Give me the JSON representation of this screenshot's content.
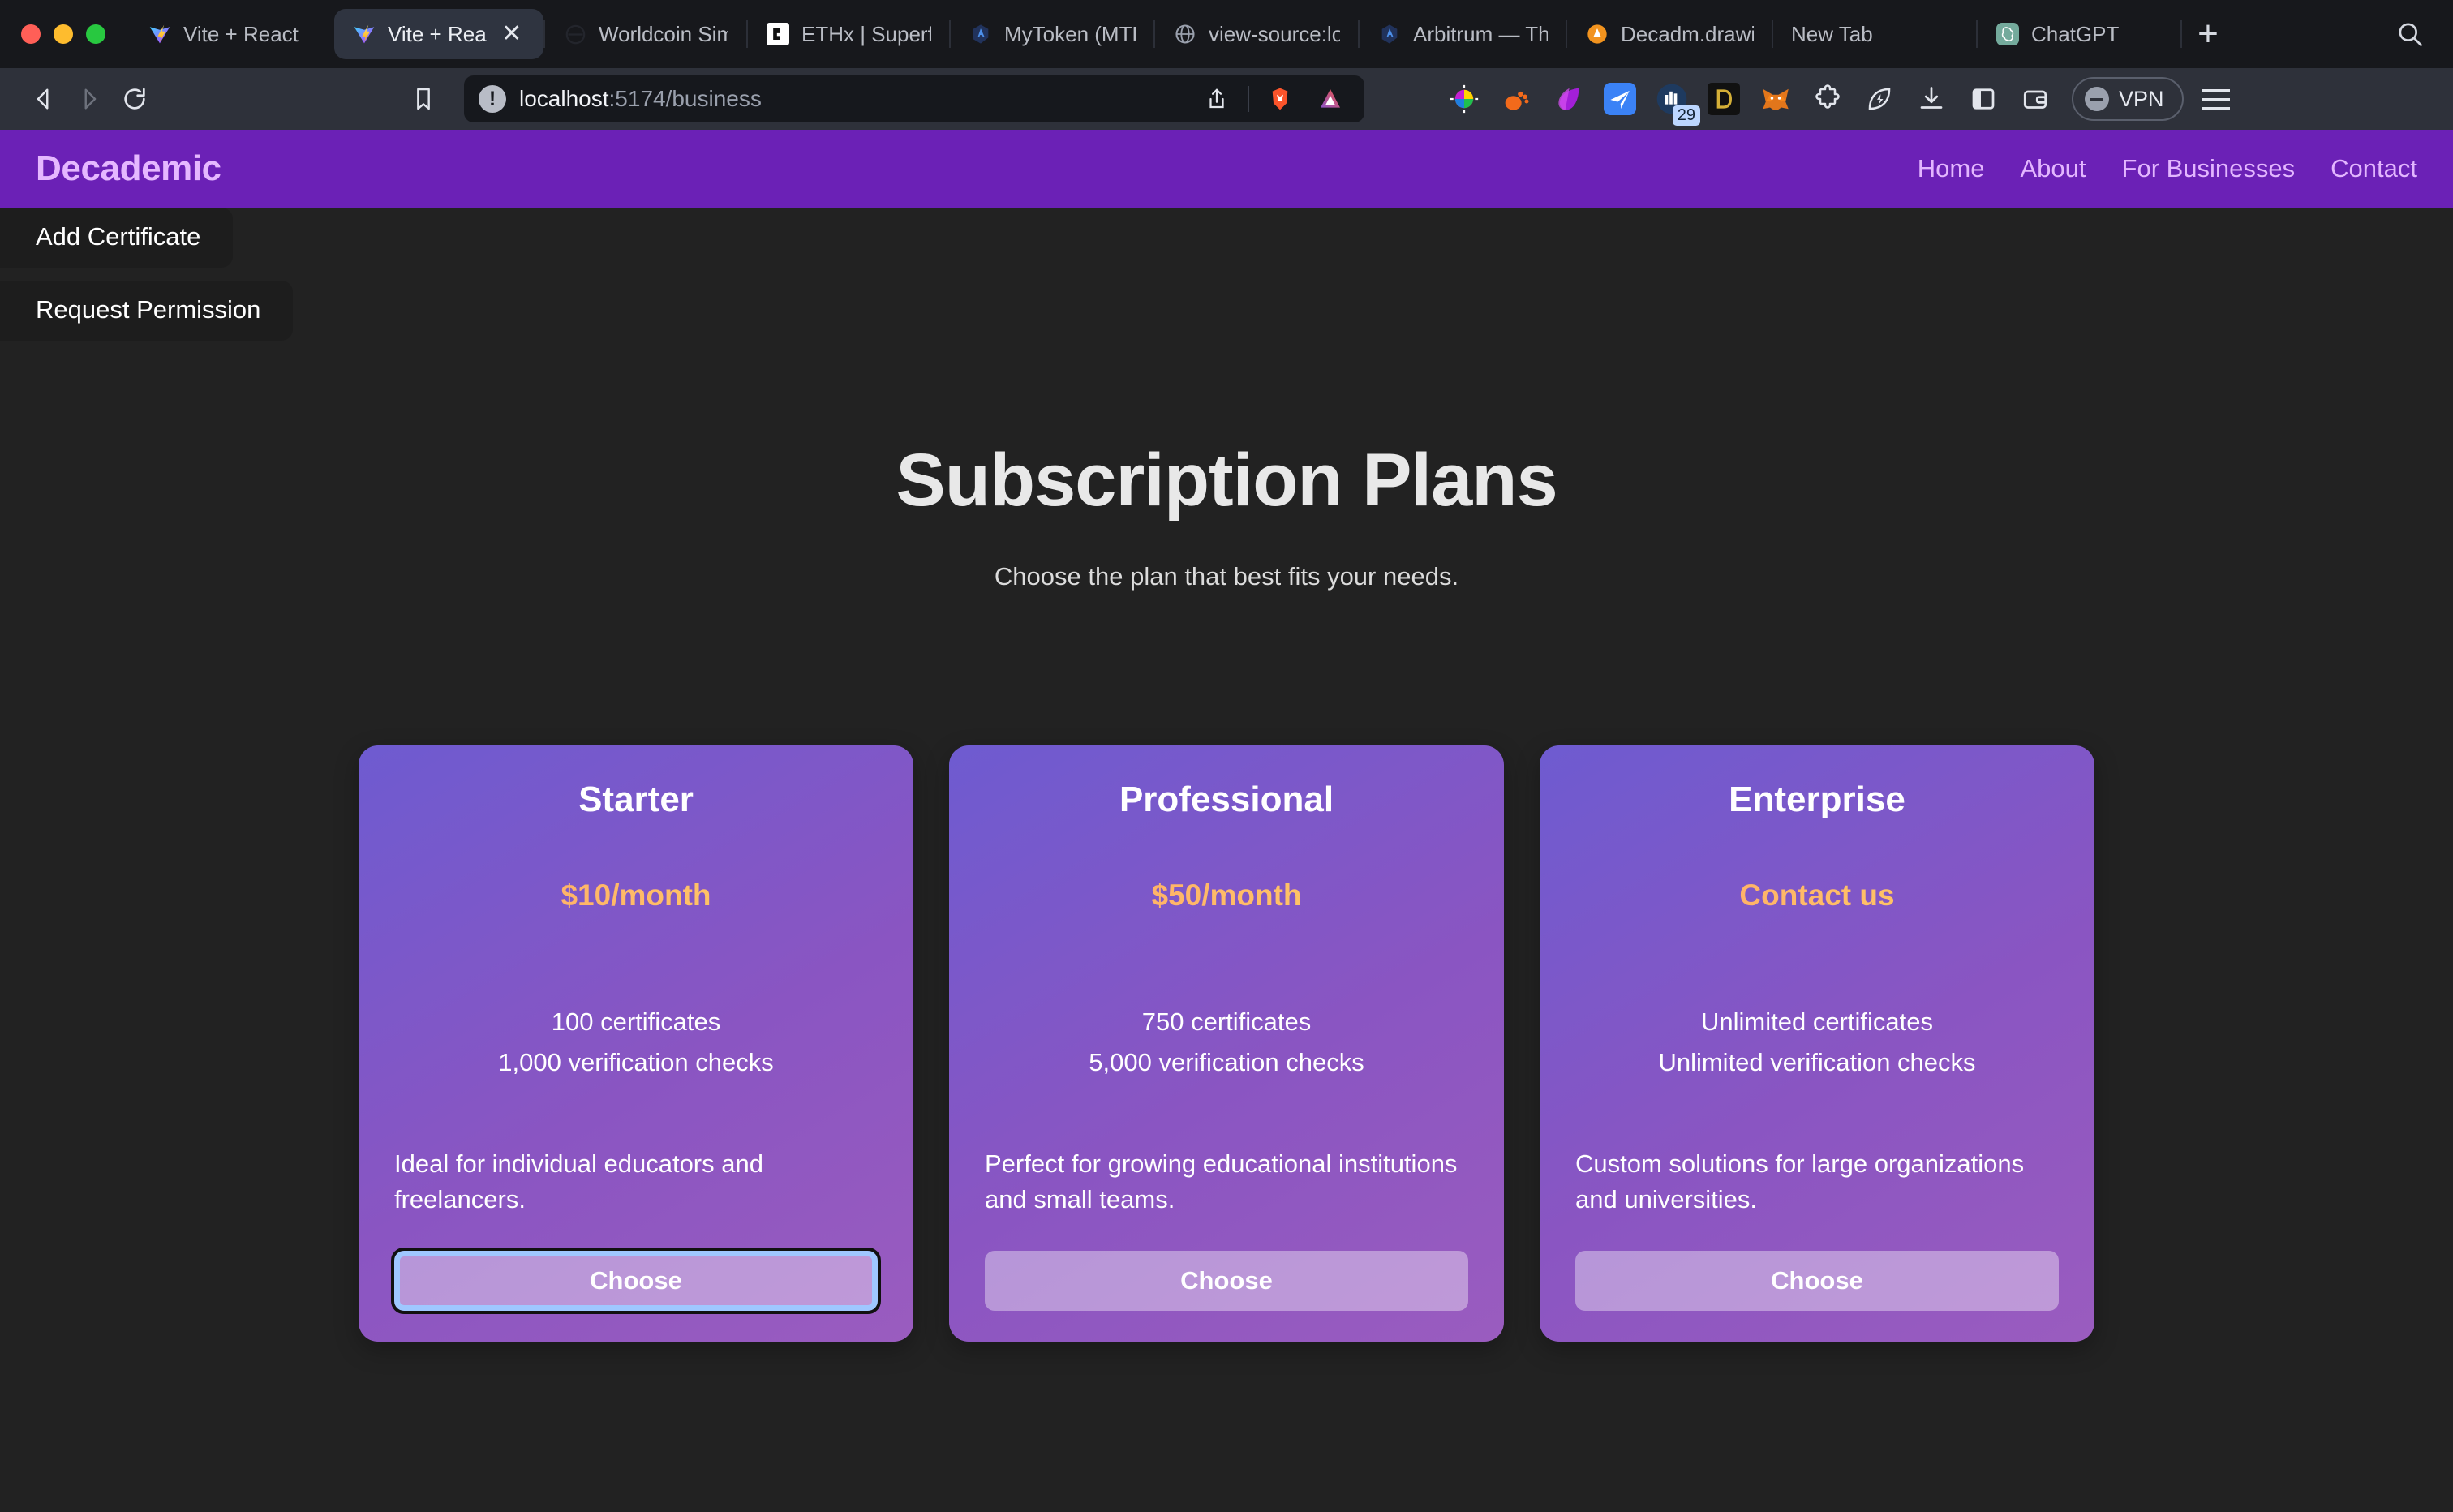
{
  "window": {
    "traffic_lights": [
      "close",
      "minimize",
      "zoom"
    ],
    "tabs": [
      {
        "title": "Vite + React",
        "icon": "vite-icon",
        "active": false
      },
      {
        "title": "Vite + Rea",
        "icon": "vite-icon",
        "active": true,
        "close_label": "✕"
      },
      {
        "title": "Worldcoin Simu",
        "icon": "worldcoin-icon",
        "active": false
      },
      {
        "title": "ETHx | Superflu",
        "icon": "ethx-icon",
        "active": false
      },
      {
        "title": "MyToken (MTK)",
        "icon": "etherscan-icon",
        "active": false
      },
      {
        "title": "view-source:lo",
        "icon": "globe-icon",
        "active": false
      },
      {
        "title": "Arbitrum — The",
        "icon": "etherscan-icon",
        "active": false
      },
      {
        "title": "Decadm.drawio",
        "icon": "drawio-icon",
        "active": false
      },
      {
        "title": "New Tab",
        "icon": "",
        "active": false
      },
      {
        "title": "ChatGPT",
        "icon": "chatgpt-icon",
        "active": false
      }
    ],
    "new_tab_label": "+",
    "tab_search_icon": "search-icon"
  },
  "toolbar": {
    "back_icon": "back-arrow-icon",
    "forward_icon": "forward-arrow-icon",
    "reload_icon": "reload-icon",
    "bookmark_icon": "bookmark-icon",
    "url": {
      "host": "localhost",
      "rest": ":5174/business",
      "security_icon": "not-secure-icon"
    },
    "share_icon": "share-icon",
    "brave_shields_icon": "brave-lion-icon",
    "brave_rewards_icon": "brave-triangle-icon",
    "extensions": [
      "color-picker-icon",
      "orange-paw-icon",
      "purple-leaf-icon",
      "blue-paper-plane-icon",
      "calendar-29-icon",
      "dlion-icon",
      "metamask-fox-icon",
      "puzzle-extensions-icon",
      "leaf-bolt-icon",
      "downloads-icon",
      "sidebar-icon",
      "wallet-icon"
    ],
    "calendar_badge": "29",
    "vpn_label": "VPN",
    "menu_icon": "hamburger-menu-icon"
  },
  "site": {
    "brand": "Decademic",
    "nav": [
      {
        "label": "Home"
      },
      {
        "label": "About"
      },
      {
        "label": "For Businesses"
      },
      {
        "label": "Contact"
      }
    ],
    "actions": [
      {
        "label": "Add Certificate"
      },
      {
        "label": "Request Permission"
      }
    ],
    "hero": {
      "title": "Subscription Plans",
      "subtitle": "Choose the plan that best fits your needs."
    },
    "plans": [
      {
        "name": "Starter",
        "price": "$10/month",
        "features": [
          "100 certificates",
          "1,000 verification checks"
        ],
        "description": "Ideal for individual educators and freelancers.",
        "cta": "Choose",
        "focused": true
      },
      {
        "name": "Professional",
        "price": "$50/month",
        "features": [
          "750 certificates",
          "5,000 verification checks"
        ],
        "description": "Perfect for growing educational institutions and small teams.",
        "cta": "Choose",
        "focused": false
      },
      {
        "name": "Enterprise",
        "price": "Contact us",
        "features": [
          "Unlimited certificates",
          "Unlimited verification checks"
        ],
        "description": "Custom solutions for large organizations and universities.",
        "cta": "Choose",
        "focused": false
      }
    ]
  },
  "colors": {
    "nav_purple": "#6b21b6",
    "brand_text": "#e5b8ff",
    "page_bg": "#222222",
    "card_gradient_from": "#6e5bd0",
    "card_gradient_to": "#9a5cbf",
    "price_accent": "#ffb36b",
    "chrome_bg": "#17181c",
    "toolbar_bg": "#2e313a"
  }
}
